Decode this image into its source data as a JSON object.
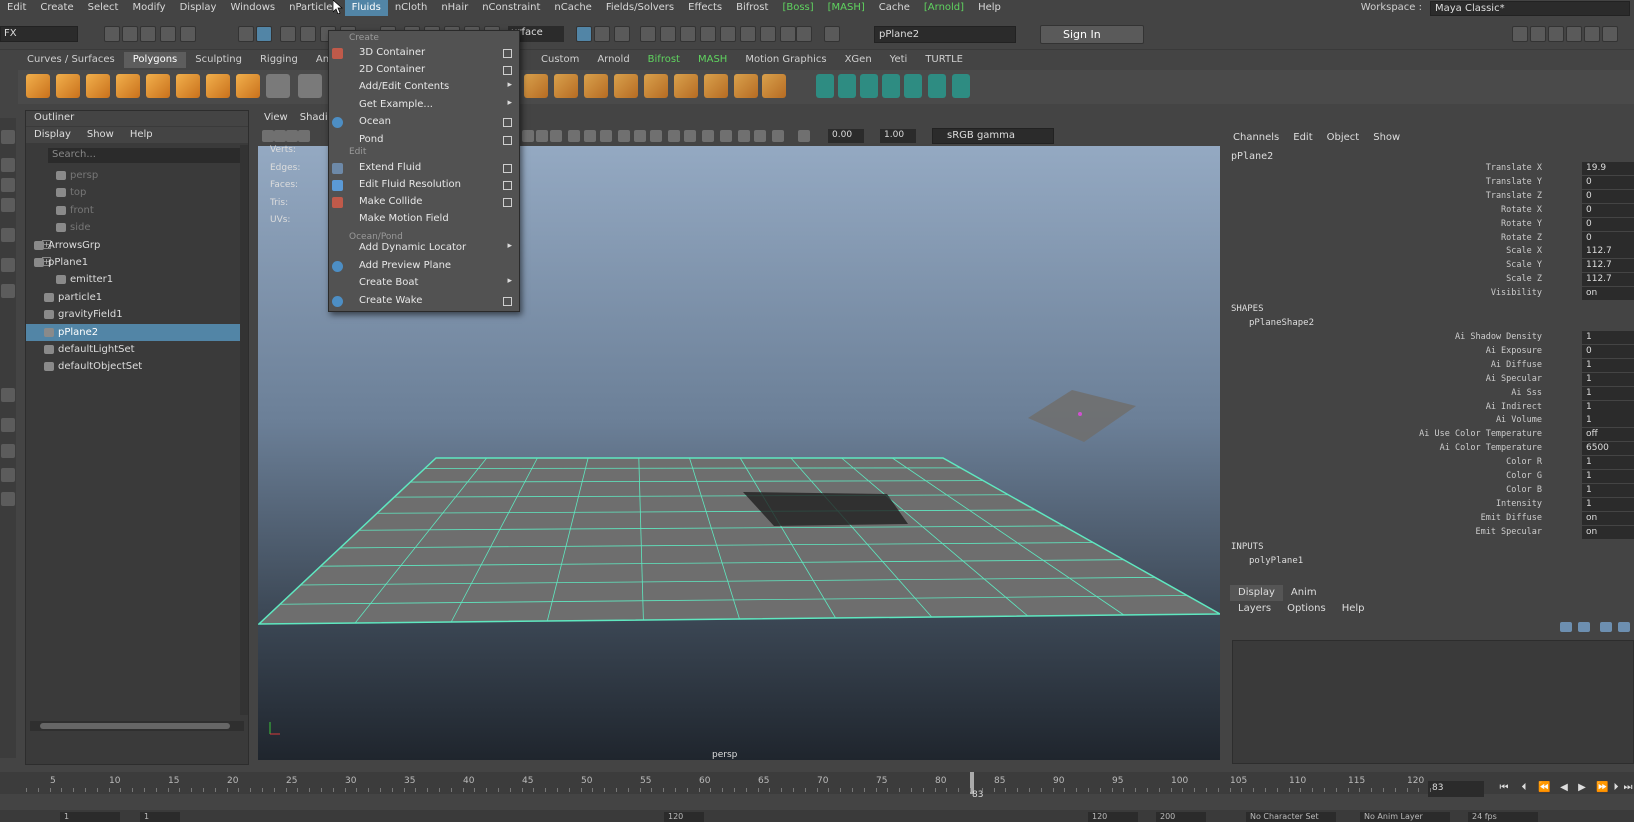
{
  "menubar": {
    "items": [
      "Edit",
      "Create",
      "Select",
      "Modify",
      "Display",
      "Windows",
      "nParticles",
      "Fluids",
      "nCloth",
      "nHair",
      "nConstraint",
      "nCache",
      "Fields/Solvers",
      "Effects",
      "Bifrost",
      "[Boss]",
      "[MASH]",
      "Cache",
      "[Arnold]",
      "Help"
    ],
    "active": "Fluids",
    "workspace_label": "Workspace :",
    "workspace_value": "Maya Classic*"
  },
  "statusline": {
    "mode": "FX",
    "surface": "urface",
    "object_field": "pPlane2",
    "sign_in": "Sign In"
  },
  "shelf_tabs": [
    "Curves / Surfaces",
    "Polygons",
    "Sculpting",
    "Rigging",
    "Anim"
  ],
  "shelf_tabs_selected": "Polygons",
  "shelf_tabs_right": [
    "Custom",
    "Arnold",
    "Bifrost",
    "MASH",
    "Motion Graphics",
    "XGen",
    "Yeti",
    "TURTLE"
  ],
  "outliner": {
    "title": "Outliner",
    "menu": [
      "Display",
      "Show",
      "Help"
    ],
    "search_placeholder": "Search...",
    "rows": [
      {
        "label": "persp",
        "dim": true
      },
      {
        "label": "top",
        "dim": true
      },
      {
        "label": "front",
        "dim": true
      },
      {
        "label": "side",
        "dim": true
      },
      {
        "label": "ArrowsGrp",
        "dim": false
      },
      {
        "label": "pPlane1",
        "dim": false
      },
      {
        "label": "emitter1",
        "dim": false
      },
      {
        "label": "particle1",
        "dim": false
      },
      {
        "label": "gravityField1",
        "dim": false
      },
      {
        "label": "pPlane2",
        "dim": false,
        "selected": true
      },
      {
        "label": "defaultLightSet",
        "dim": false
      },
      {
        "label": "defaultObjectSet",
        "dim": false
      }
    ]
  },
  "viewport": {
    "menu": [
      "View",
      "Shadi"
    ],
    "hud": [
      "Verts:",
      "Edges:",
      "Faces:",
      "Tris:",
      "UVs:"
    ],
    "exposure": "0.00",
    "gamma_value": "1.00",
    "color_space": "sRGB gamma",
    "camera_label": "persp"
  },
  "fluids_menu": {
    "sections": {
      "create": "Create",
      "edit": "Edit",
      "ocean": "Ocean/Pond"
    },
    "items": [
      {
        "label": "3D Container",
        "kind": "box"
      },
      {
        "label": "2D Container",
        "kind": "box"
      },
      {
        "label": "Add/Edit Contents",
        "kind": "arrow"
      },
      {
        "label": "Get Example...",
        "kind": "arrow"
      },
      {
        "label": "Ocean",
        "kind": "box"
      },
      {
        "label": "Pond",
        "kind": "box"
      },
      {
        "label": "Extend Fluid",
        "kind": "box"
      },
      {
        "label": "Edit Fluid Resolution",
        "kind": "box"
      },
      {
        "label": "Make Collide",
        "kind": "box"
      },
      {
        "label": "Make Motion Field",
        "kind": "none"
      },
      {
        "label": "Add Dynamic Locator",
        "kind": "arrow"
      },
      {
        "label": "Add Preview Plane",
        "kind": "none"
      },
      {
        "label": "Create Boat",
        "kind": "arrow"
      },
      {
        "label": "Create Wake",
        "kind": "box"
      }
    ]
  },
  "channelbox": {
    "menu": [
      "Channels",
      "Edit",
      "Object",
      "Show"
    ],
    "object": "pPlane2",
    "attrs": [
      {
        "name": "Translate X",
        "value": "19.9"
      },
      {
        "name": "Translate Y",
        "value": "0"
      },
      {
        "name": "Translate Z",
        "value": "0"
      },
      {
        "name": "Rotate X",
        "value": "0"
      },
      {
        "name": "Rotate Y",
        "value": "0"
      },
      {
        "name": "Rotate Z",
        "value": "0"
      },
      {
        "name": "Scale X",
        "value": "112.7"
      },
      {
        "name": "Scale Y",
        "value": "112.7"
      },
      {
        "name": "Scale Z",
        "value": "112.7"
      },
      {
        "name": "Visibility",
        "value": "on"
      }
    ],
    "shapes_header": "SHAPES",
    "shape_name": "pPlaneShape2",
    "shape_attrs": [
      {
        "name": "Ai Shadow Density",
        "value": "1"
      },
      {
        "name": "Ai Exposure",
        "value": "0"
      },
      {
        "name": "Ai Diffuse",
        "value": "1"
      },
      {
        "name": "Ai Specular",
        "value": "1"
      },
      {
        "name": "Ai Sss",
        "value": "1"
      },
      {
        "name": "Ai Indirect",
        "value": "1"
      },
      {
        "name": "Ai Volume",
        "value": "1"
      },
      {
        "name": "Ai Use Color Temperature",
        "value": "off"
      },
      {
        "name": "Ai Color Temperature",
        "value": "6500"
      },
      {
        "name": "Color R",
        "value": "1"
      },
      {
        "name": "Color G",
        "value": "1"
      },
      {
        "name": "Color B",
        "value": "1"
      },
      {
        "name": "Intensity",
        "value": "1"
      },
      {
        "name": "Emit Diffuse",
        "value": "on"
      },
      {
        "name": "Emit Specular",
        "value": "on"
      }
    ],
    "inputs_header": "INPUTS",
    "input_name": "polyPlane1"
  },
  "layer_editor": {
    "tabs": [
      "Display",
      "Anim"
    ],
    "menu": [
      "Layers",
      "Options",
      "Help"
    ]
  },
  "timeslider": {
    "ticks": [
      "5",
      "10",
      "15",
      "20",
      "25",
      "30",
      "35",
      "40",
      "45",
      "50",
      "55",
      "60",
      "65",
      "70",
      "75",
      "80",
      "85",
      "90",
      "95",
      "100",
      "105",
      "110",
      "115",
      "120"
    ],
    "current_frame": "83",
    "frame_field": "83"
  },
  "rangebar": {
    "start": "1",
    "start2": "1",
    "end": "120",
    "end2": "120",
    "max": "200",
    "character_set": "No Character Set",
    "anim_layer": "No Anim Layer",
    "fps": "24 fps"
  },
  "colors": {
    "accent": "#5285a6",
    "grid": "#5fe8c0",
    "bg": "#444444"
  }
}
